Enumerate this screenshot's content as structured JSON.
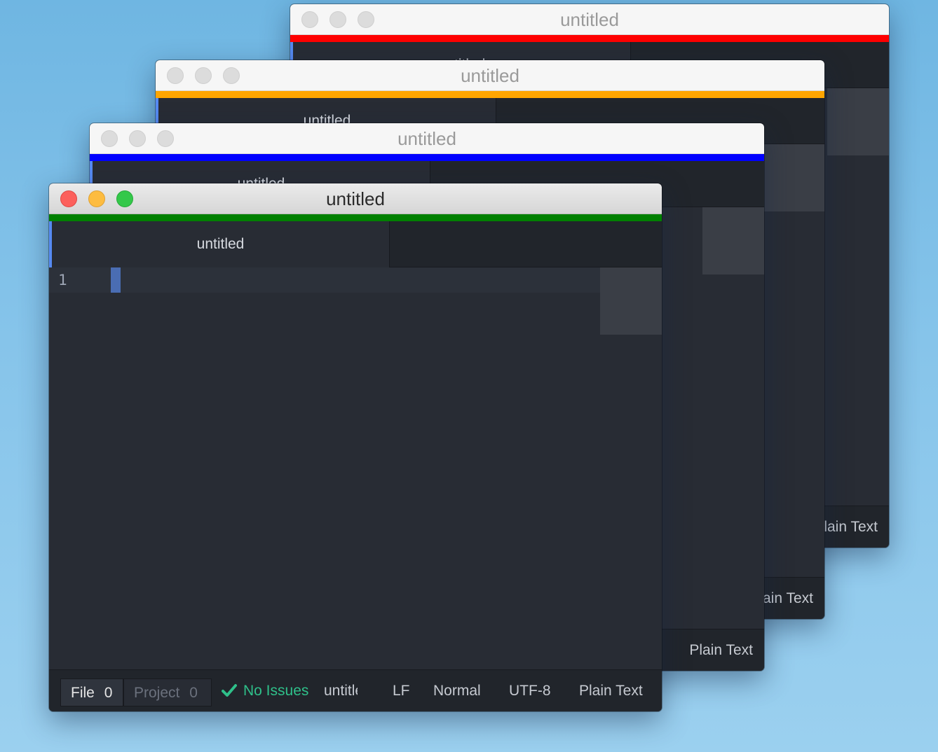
{
  "windows": {
    "red": {
      "title": "untitled",
      "tab_label": "untitled",
      "status_grammar": "Plain Text",
      "accent_color": "#ff0000"
    },
    "orange": {
      "title": "untitled",
      "tab_label": "untitled",
      "status_grammar": "Plain Text",
      "accent_color": "#ffa500"
    },
    "blue": {
      "title": "untitled",
      "tab_label": "untitled",
      "status_grammar": "Plain Text",
      "accent_color": "#0000ff"
    },
    "green": {
      "title": "untitled",
      "tab_label": "untitled",
      "accent_color": "#008000",
      "editor": {
        "line_number": "1"
      },
      "status": {
        "linter_file_label": "File",
        "linter_file_count": "0",
        "linter_project_label": "Project",
        "linter_project_count": "0",
        "check_icon": "checkmark-icon",
        "no_issues": "No Issues",
        "file_name": "untitled",
        "line_ending": "LF",
        "mode": "Normal",
        "encoding": "UTF-8",
        "grammar": "Plain Text"
      }
    }
  }
}
